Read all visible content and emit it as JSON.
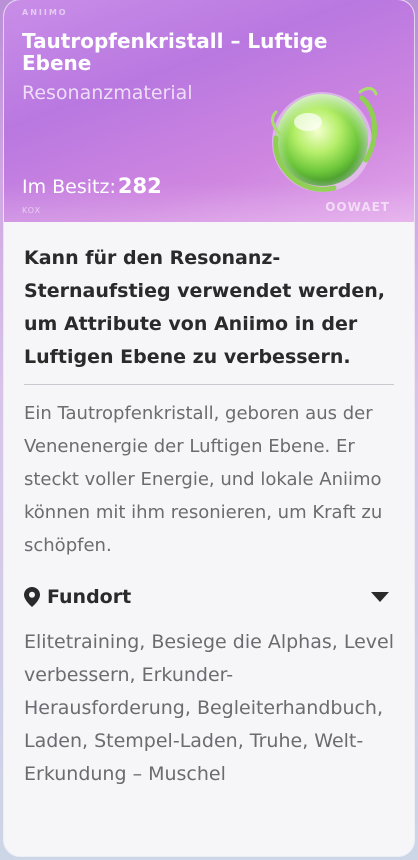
{
  "header": {
    "brand_top": "ANIIMO",
    "title": "Tautropfenkristall – Luftige Ebene",
    "subtitle": "Resonanzmaterial",
    "owned_label": "Im Besitz:",
    "owned_count": "282",
    "brand_bottom_left": "KOX",
    "brand_bottom_right": "OOWAET"
  },
  "body": {
    "usage": "Kann für den Resonanz-Sternaufstieg verwendet werden, um Attribute von Aniimo in der Luftigen Ebene zu verbessern.",
    "description": "Ein Tautropfenkristall, geboren aus der Venenenergie der Luftigen Ebene. Er steckt voller Energie, und lokale Aniimo können mit ihm resonieren, um Kraft zu schöpfen.",
    "fundort_label": "Fundort",
    "sources": "Elitetraining, Besiege die Alphas, Level verbessern, Erkunder-Herausforderung, Begleiterhandbuch, Laden, Stempel-Laden, Truhe, Welt-Erkundung – Muschel"
  },
  "icons": {
    "location": "location-pin-icon",
    "expand": "triangle-down-icon",
    "item": "dewdrop-crystal-icon"
  },
  "colors": {
    "header_gradient_start": "#c98ee8",
    "header_gradient_end": "#e2a6ea",
    "card_bg": "#f6f5f8",
    "primary_text": "#2a2a2a",
    "secondary_text": "#6b6b70"
  }
}
